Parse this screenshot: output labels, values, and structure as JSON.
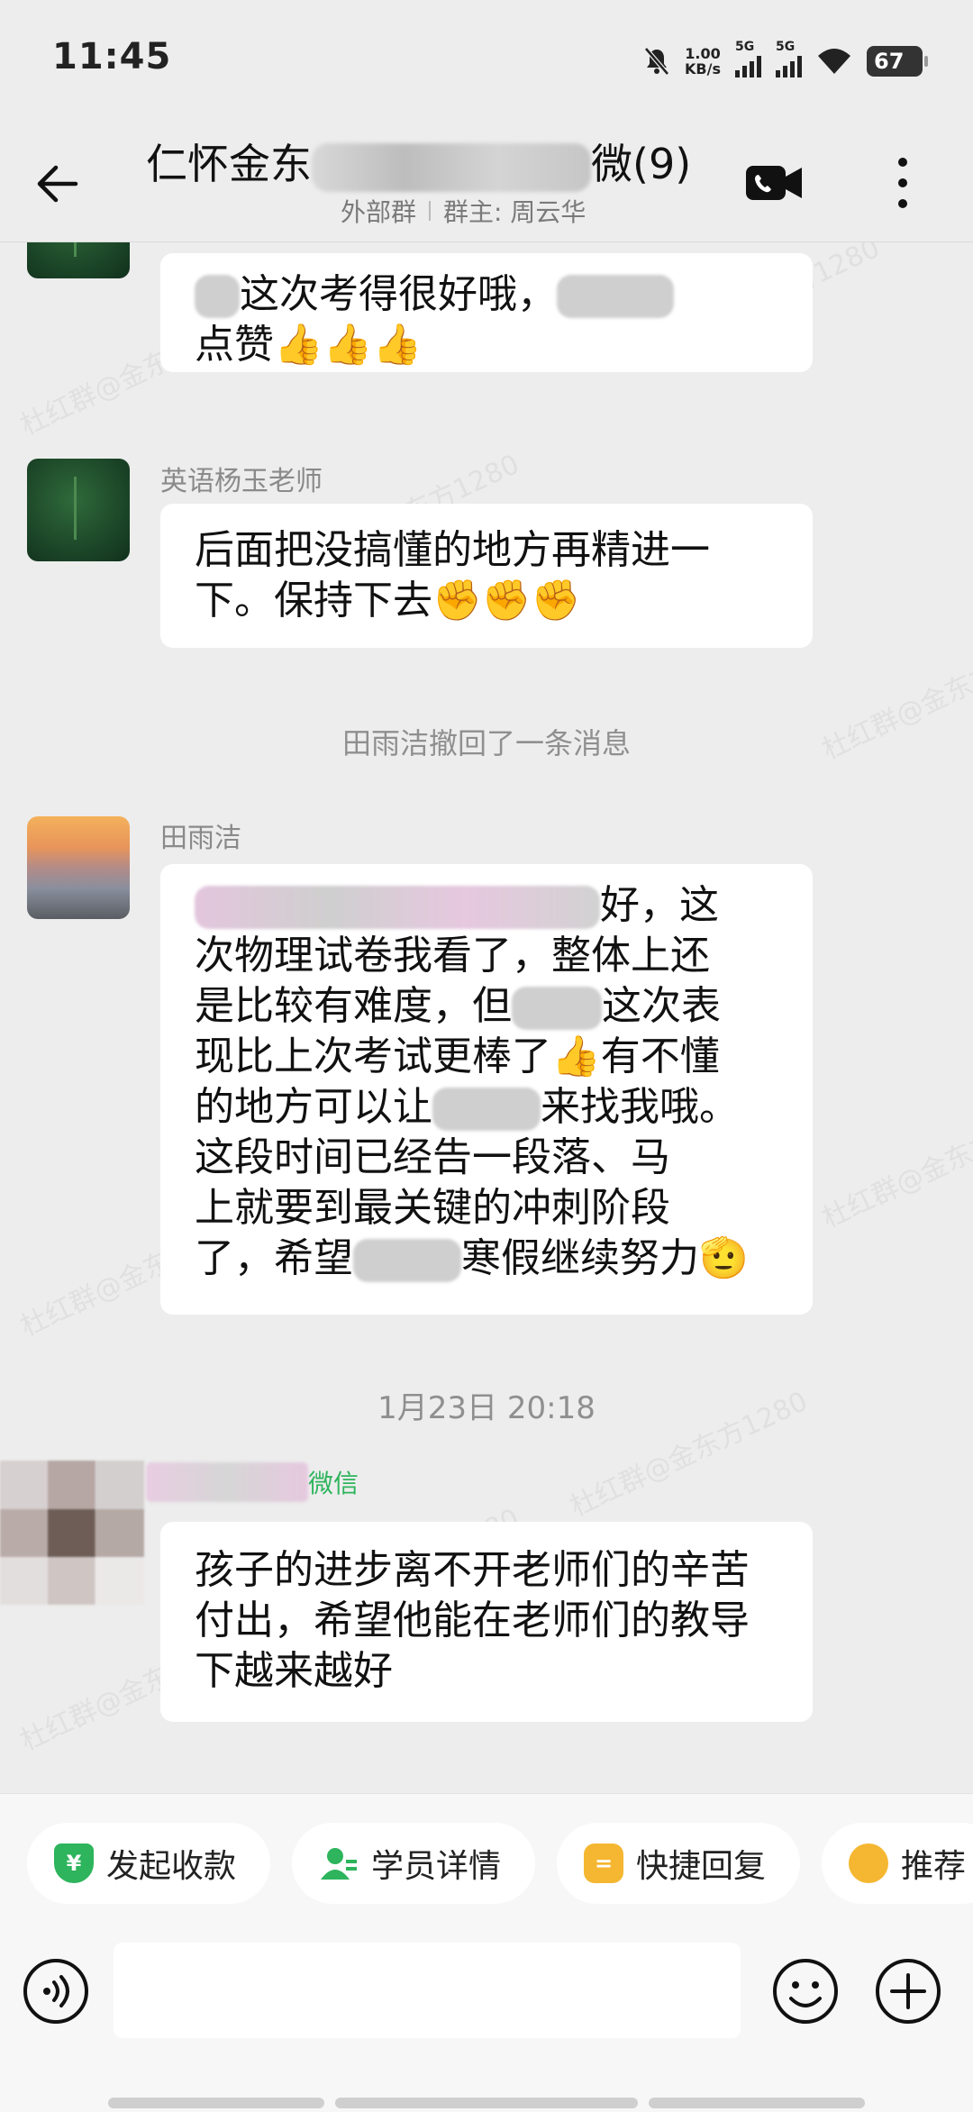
{
  "status_bar": {
    "time": "11:45",
    "net_speed_value": "1.00",
    "net_speed_unit": "KB/s",
    "signal1_label": "5G",
    "signal2_label": "5G",
    "battery": "67"
  },
  "header": {
    "title_prefix": "仁怀金东",
    "title_suffix": "微",
    "member_count": "(9)",
    "group_type": "外部群",
    "owner_label": "群主: 周云华"
  },
  "messages": [
    {
      "sender": "",
      "text_line1": "这次考得很好哦，",
      "text_line2": "点赞👍👍👍"
    },
    {
      "sender": "英语杨玉老师",
      "text": "后面把没搞懂的地方再精进一下。保持下去✊✊✊"
    },
    {
      "system": "田雨洁撤回了一条消息"
    },
    {
      "sender": "田雨洁",
      "line1_tail": "好，这",
      "line2": "次物理试卷我看了，整体上还",
      "line3": "是比较有难度，但",
      "line3_tail": "这次表",
      "line4": "现比上次考试更棒了👍有不懂",
      "line5": "的地方可以让",
      "line5_tail": "来找我哦。",
      "line6": "这段时间已经告一段落、马",
      "line7": "上就要到最关键的冲刺阶段",
      "line8": "了，希望",
      "line8_tail": "寒假继续努力🫡"
    },
    {
      "timestamp": "1月23日  20:18"
    },
    {
      "sender_tail": "微信",
      "text": "孩子的进步离不开老师们的辛苦付出，希望他能在老师们的教导下越来越好"
    }
  ],
  "watermark": "杜红群@金东方1280",
  "quick_actions": [
    {
      "label": "发起收款",
      "icon": "¥",
      "color": "#2DB45C"
    },
    {
      "label": "学员详情",
      "icon": "",
      "color": "#2DB45C"
    },
    {
      "label": "快捷回复",
      "icon": "=",
      "color": "#F5B731"
    },
    {
      "label": "推荐",
      "icon": "",
      "color": "#F5B731"
    }
  ],
  "input": {
    "value": "",
    "placeholder": ""
  }
}
